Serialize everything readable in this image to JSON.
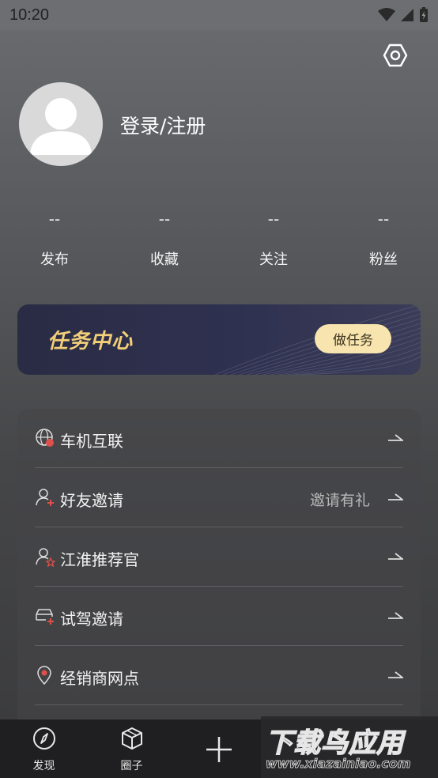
{
  "status_bar": {
    "time": "10:20"
  },
  "profile": {
    "login_label": "登录/注册"
  },
  "stats": [
    {
      "value": "--",
      "label": "发布"
    },
    {
      "value": "--",
      "label": "收藏"
    },
    {
      "value": "--",
      "label": "关注"
    },
    {
      "value": "--",
      "label": "粉丝"
    }
  ],
  "task_banner": {
    "title": "任务中心",
    "button": "做任务"
  },
  "menu": [
    {
      "label": "车机互联",
      "extra": "",
      "icon": "globe-icon"
    },
    {
      "label": "好友邀请",
      "extra": "邀请有礼",
      "icon": "add-friend-icon"
    },
    {
      "label": "江淮推荐官",
      "extra": "",
      "icon": "recommender-icon"
    },
    {
      "label": "试驾邀请",
      "extra": "",
      "icon": "car-add-icon"
    },
    {
      "label": "经销商网点",
      "extra": "",
      "icon": "location-pin-icon"
    }
  ],
  "bottom_nav": [
    {
      "label": "发现",
      "icon": "compass-icon"
    },
    {
      "label": "圈子",
      "icon": "cube-icon"
    },
    {
      "label": "",
      "icon": "plus-icon"
    }
  ],
  "watermark": {
    "title": "下载鸟应用",
    "url": "www.xiazainiao.com"
  },
  "colors": {
    "accent_gold": "#f3cf78",
    "button_gold": "#f8e4ae",
    "banner_navy": "#2f3150",
    "badge_red": "#e0504a"
  }
}
